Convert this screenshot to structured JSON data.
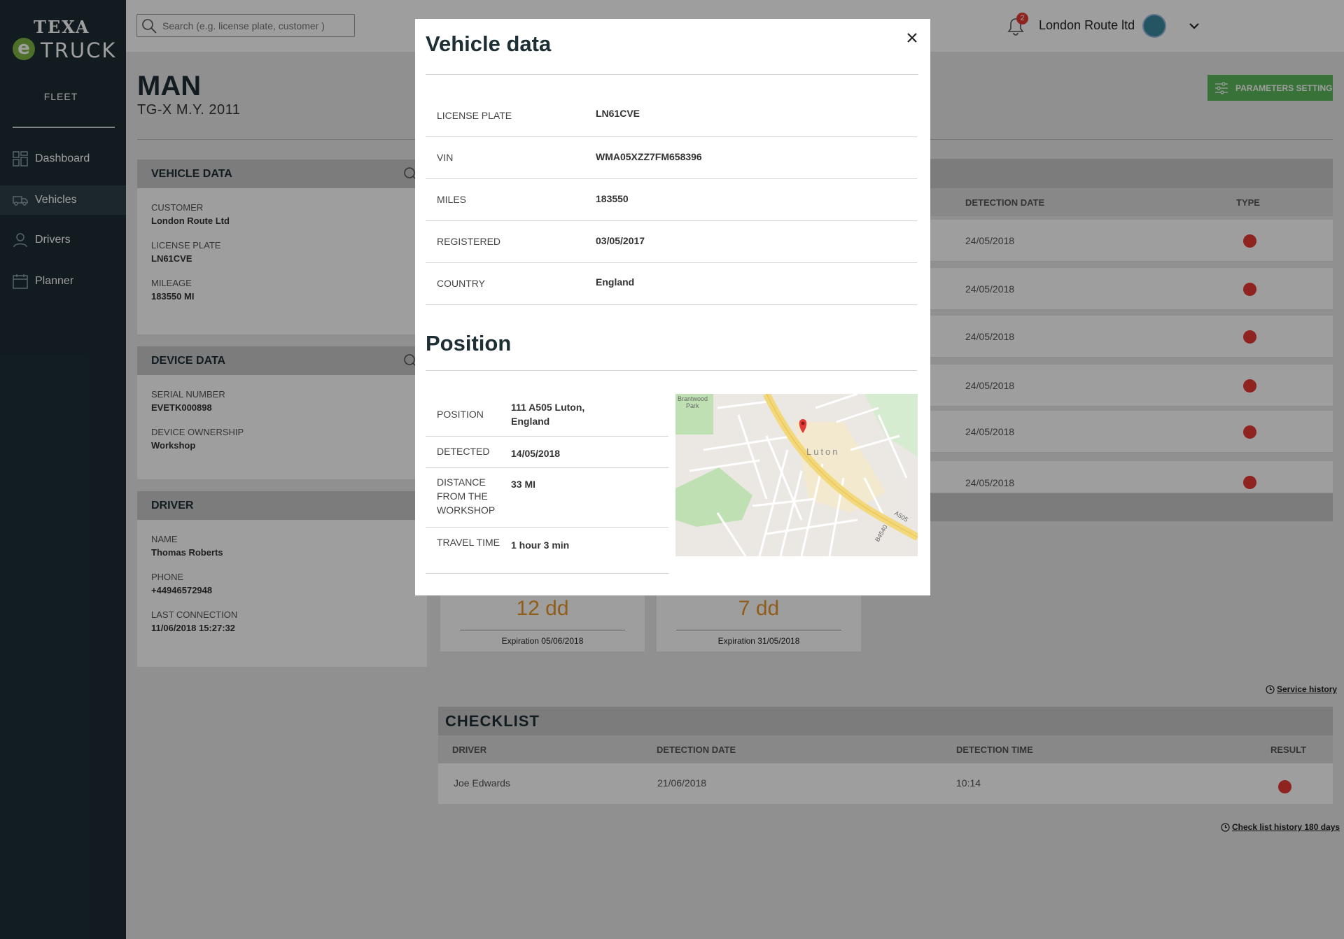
{
  "brand": {
    "logo_top": "TEXA",
    "logo_e": "e",
    "logo_bottom": "TRUCK"
  },
  "sidebar": {
    "section": "FLEET",
    "items": [
      {
        "label": "Dashboard",
        "icon": "dashboard-grid-icon"
      },
      {
        "label": "Vehicles",
        "icon": "truck-icon",
        "active": true
      },
      {
        "label": "Drivers",
        "icon": "person-icon"
      },
      {
        "label": "Planner",
        "icon": "calendar-icon"
      }
    ]
  },
  "topbar": {
    "search_placeholder": "Search (e.g. license plate, customer )",
    "notification_count": "2",
    "company": "London Route ltd"
  },
  "page": {
    "title": "MAN",
    "subtitle": "TG-X  M.Y. 2011",
    "parameters_button": "PARAMETERS SETTING"
  },
  "vehicle_card": {
    "title": "VEHICLE DATA",
    "fields": [
      {
        "label": "CUSTOMER",
        "value": "London Route Ltd"
      },
      {
        "label": "LICENSE PLATE",
        "value": "LN61CVE"
      },
      {
        "label": "MILEAGE",
        "value": "183550 MI"
      }
    ]
  },
  "device_card": {
    "title": "DEVICE DATA",
    "fields": [
      {
        "label": "SERIAL NUMBER",
        "value": "EVETK000898"
      },
      {
        "label": "DEVICE OWNERSHIP",
        "value": "Workshop"
      }
    ]
  },
  "driver_card": {
    "title": "DRIVER",
    "fields": [
      {
        "label": "NAME",
        "value": "Thomas Roberts"
      },
      {
        "label": "PHONE",
        "value": "+44946572948"
      },
      {
        "label": "LAST CONNECTION",
        "value": "11/06/2018 15:27:32"
      }
    ]
  },
  "alerts_table": {
    "columns": {
      "date": "DETECTION DATE",
      "type": "TYPE"
    },
    "rows": [
      {
        "date": "24/05/2018",
        "status_color": "#e53935"
      },
      {
        "date": "24/05/2018",
        "status_color": "#e53935"
      },
      {
        "date": "24/05/2018",
        "status_color": "#e53935"
      },
      {
        "date": "24/05/2018",
        "status_color": "#e53935"
      },
      {
        "date": "24/05/2018",
        "status_color": "#e53935"
      },
      {
        "date": "24/05/2018",
        "status_color": "#e53935"
      }
    ]
  },
  "expirations": [
    {
      "days": "12 dd",
      "label": "Expiration 05/06/2018"
    },
    {
      "days": "7 dd",
      "label": "Expiration 31/05/2018"
    }
  ],
  "links": {
    "service_history": "Service history",
    "checklist_history": "Check list history 180 days"
  },
  "checklist": {
    "title": "CHECKLIST",
    "columns": {
      "driver": "DRIVER",
      "date": "DETECTION DATE",
      "time": "DETECTION TIME",
      "result": "RESULT"
    },
    "rows": [
      {
        "driver": "Joe Edwards",
        "date": "21/06/2018",
        "time": "10:14",
        "status_color": "#e53935"
      }
    ]
  },
  "modal": {
    "title": "Vehicle data",
    "rows": [
      {
        "label": "LICENSE PLATE",
        "value": "LN61CVE"
      },
      {
        "label": "VIN",
        "value": "WMA05XZZ7FM658396"
      },
      {
        "label": "MILES",
        "value": "183550"
      },
      {
        "label": "REGISTERED",
        "value": "03/05/2017"
      },
      {
        "label": "COUNTRY",
        "value": "England"
      }
    ],
    "position_title": "Position",
    "position_rows": [
      {
        "label": "POSITION",
        "value": "111 A505 Luton, England"
      },
      {
        "label": "DETECTED",
        "value": "14/05/2018"
      },
      {
        "label": "DISTANCE FROM THE WORKSHOP",
        "value": "33 MI"
      },
      {
        "label": "TRAVEL TIME",
        "value": "1 hour 3 min"
      }
    ],
    "map": {
      "city_label": "Luton",
      "park_label": "Brantwood Park",
      "road_labels": [
        "A505",
        "B4540"
      ]
    }
  },
  "colors": {
    "sidebar": "#1d2e35",
    "accent_green": "#5cb85c",
    "logo_green": "#7cb342",
    "alert_red": "#e53935",
    "expiration_orange": "#e8962a"
  }
}
